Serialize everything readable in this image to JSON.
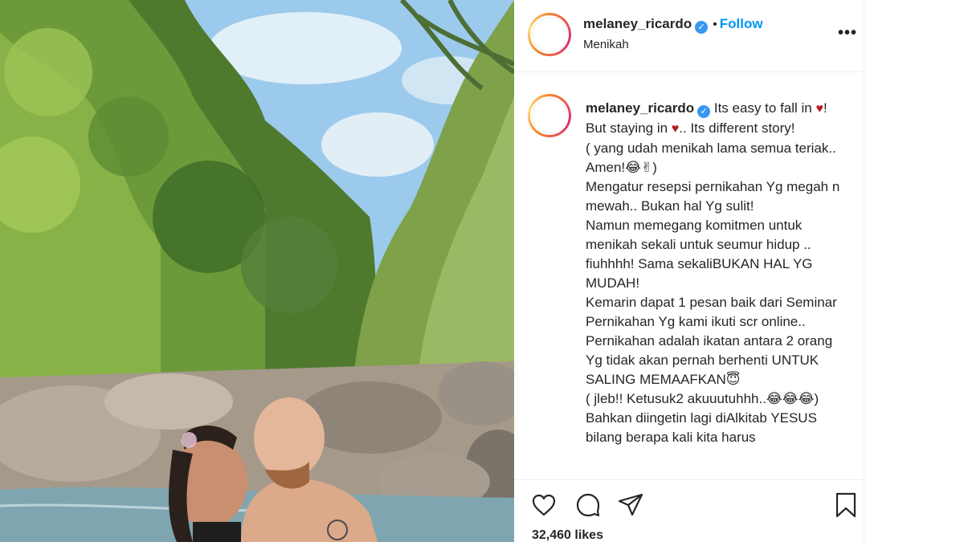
{
  "post": {
    "username": "melaney_ricardo",
    "verified_mark": "✓",
    "follow_label": "Follow",
    "separator": "•",
    "location": "Menikah",
    "more_label": "•••"
  },
  "caption": {
    "username": "melaney_ricardo",
    "text_1": " Its easy to fall in ",
    "heart_1": "♥",
    "text_2": "!\nBut staying in ",
    "heart_2": "♥",
    "text_3": ".. Its different story!\n( yang udah menikah lama semua teriak.. Amen!😂✌)\nMengatur resepsi pernikahan Yg megah n mewah.. Bukan hal Yg sulit!\nNamun memegang komitmen untuk menikah sekali untuk seumur hidup .. fiuhhhh! Sama sekaliBUKAN HAL YG MUDAH!\nKemarin dapat 1 pesan baik dari Seminar Pernikahan Yg kami ikuti scr online..\nPernikahan adalah ikatan antara 2 orang Yg tidak akan pernah berhenti UNTUK SALING MEMAAFKAN😇\n( jleb!! Ketusuk2 akuuutuhhh..😂😂😂)\nBahkan diingetin lagi diAlkitab YESUS bilang berapa kali kita harus"
  },
  "actions": {
    "icons": [
      "heart-icon",
      "comment-icon",
      "share-icon",
      "bookmark-icon"
    ]
  },
  "likes": "32,460 likes",
  "colors": {
    "accent": "#0095f6",
    "verified": "#3897f0",
    "heart": "#b71c1c",
    "border": "#efefef"
  }
}
